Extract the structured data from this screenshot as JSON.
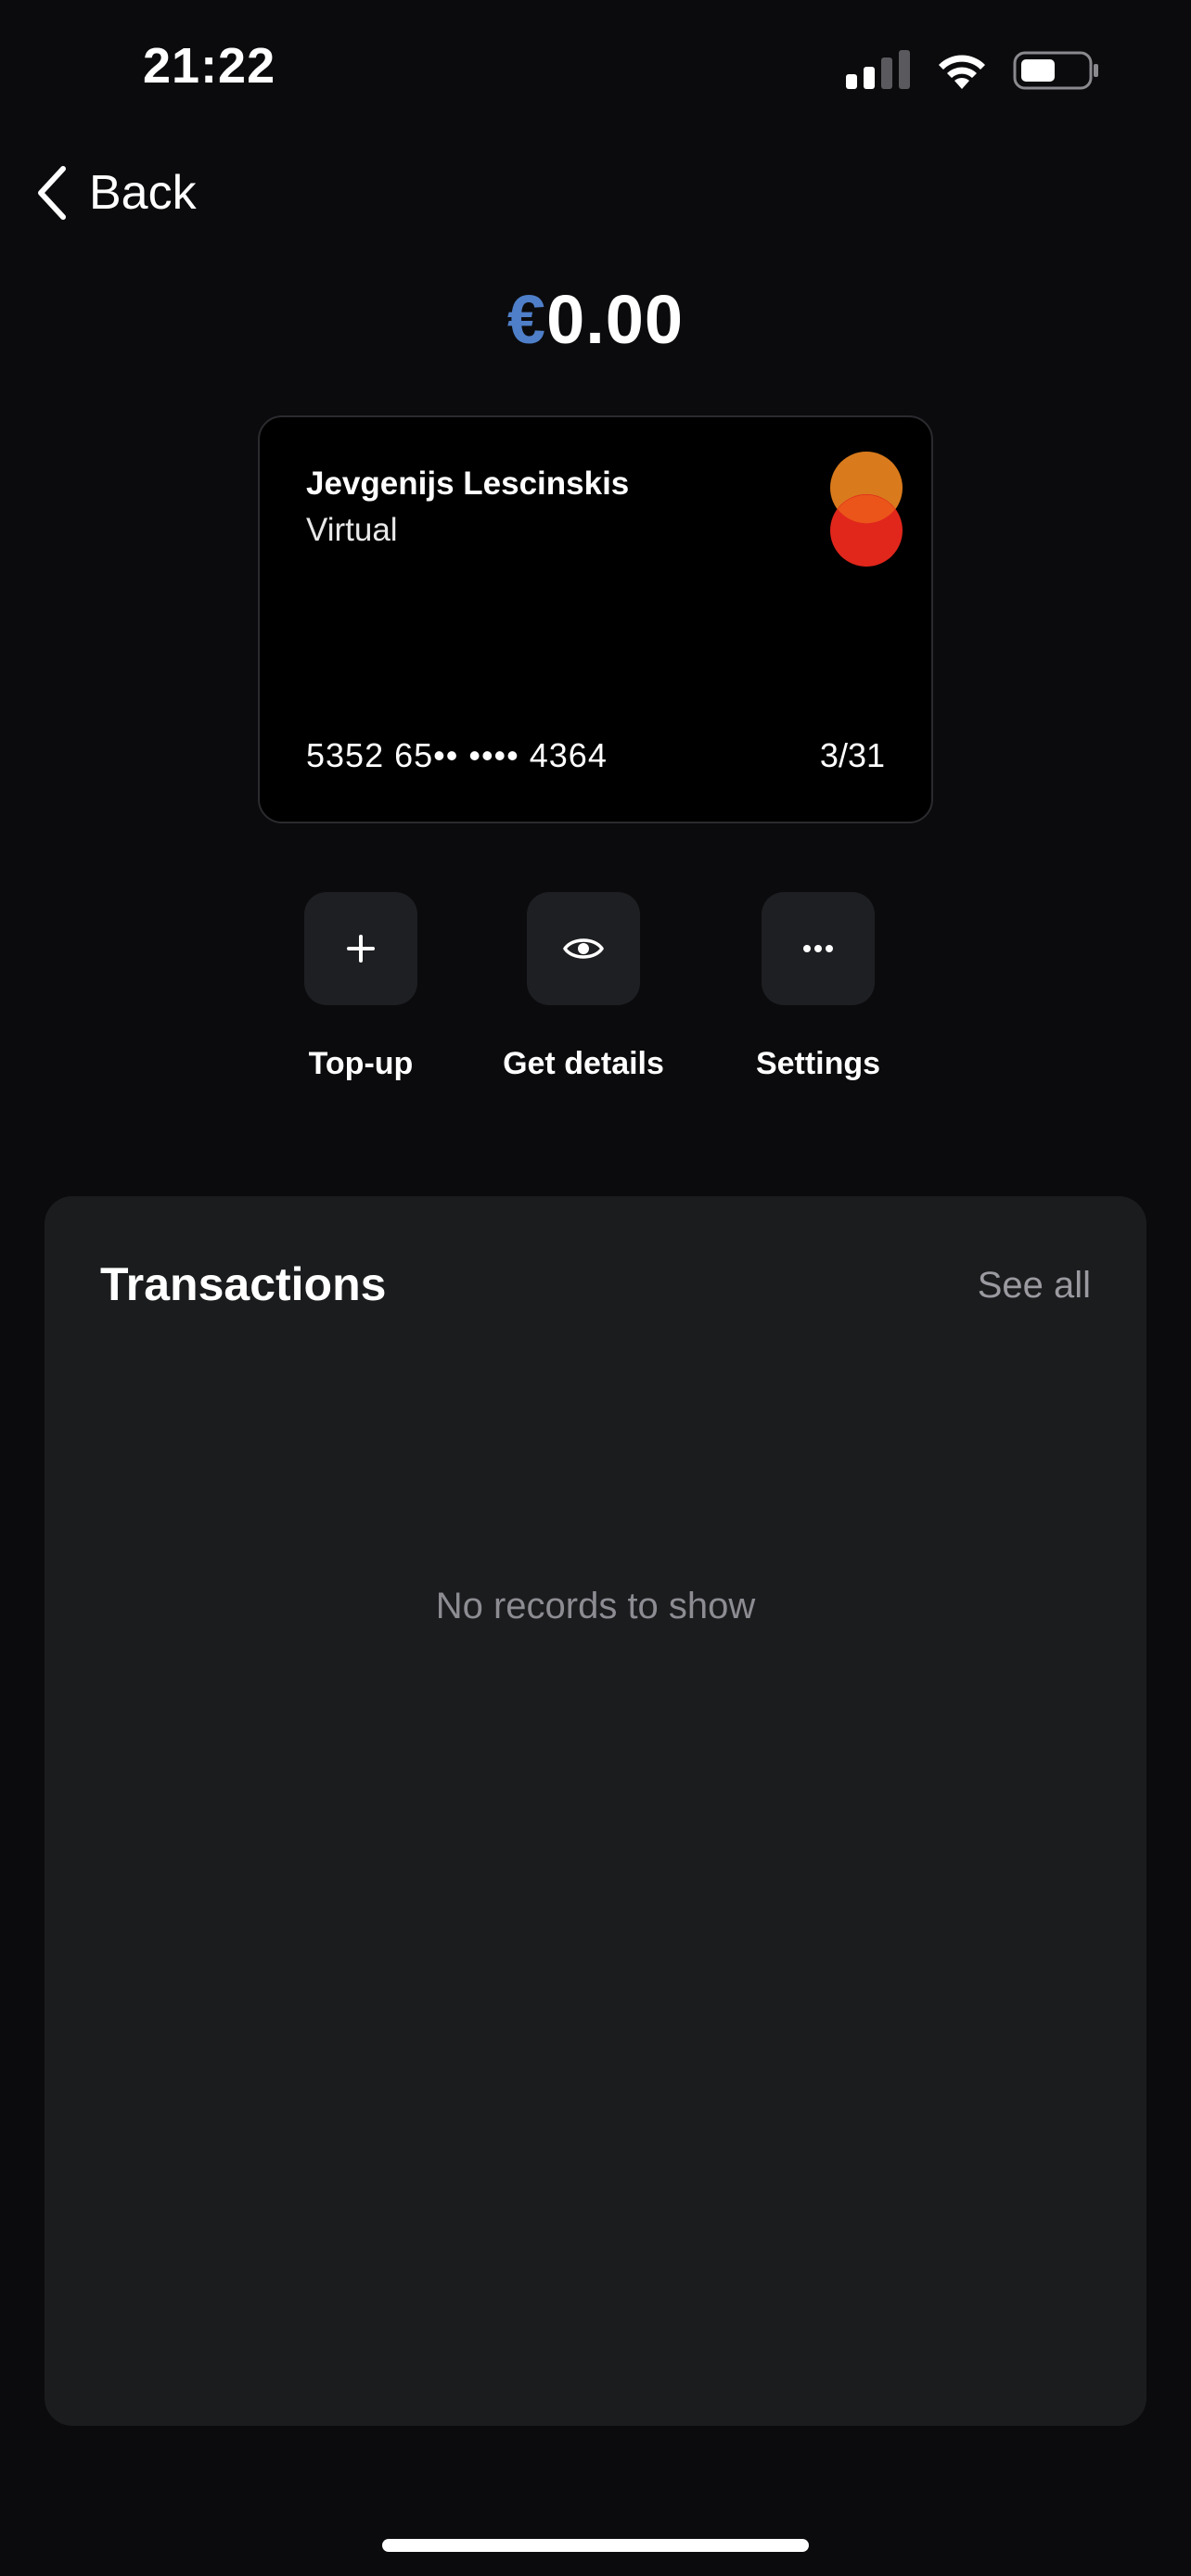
{
  "status_bar": {
    "time": "21:22",
    "icons": [
      "signal-icon",
      "wifi-icon",
      "battery-icon"
    ]
  },
  "nav": {
    "back_label": "Back"
  },
  "balance": {
    "currency_symbol": "€",
    "amount": "0.00"
  },
  "card": {
    "holder_name": "Jevgenijs Lescinskis",
    "type": "Virtual",
    "number": "5352 65•• •••• 4364",
    "expiry": "3/31",
    "brand_icon": "mastercard-logo-icon"
  },
  "actions": [
    {
      "label": "Top-up",
      "icon": "plus-icon"
    },
    {
      "label": "Get details",
      "icon": "eye-icon"
    },
    {
      "label": "Settings",
      "icon": "more-icon"
    }
  ],
  "transactions": {
    "title": "Transactions",
    "see_all_label": "See all",
    "empty_message": "No records to show"
  },
  "colors": {
    "background": "#0b0b0d",
    "panel": "#1b1c1e",
    "accent": "#4f7fc9"
  }
}
